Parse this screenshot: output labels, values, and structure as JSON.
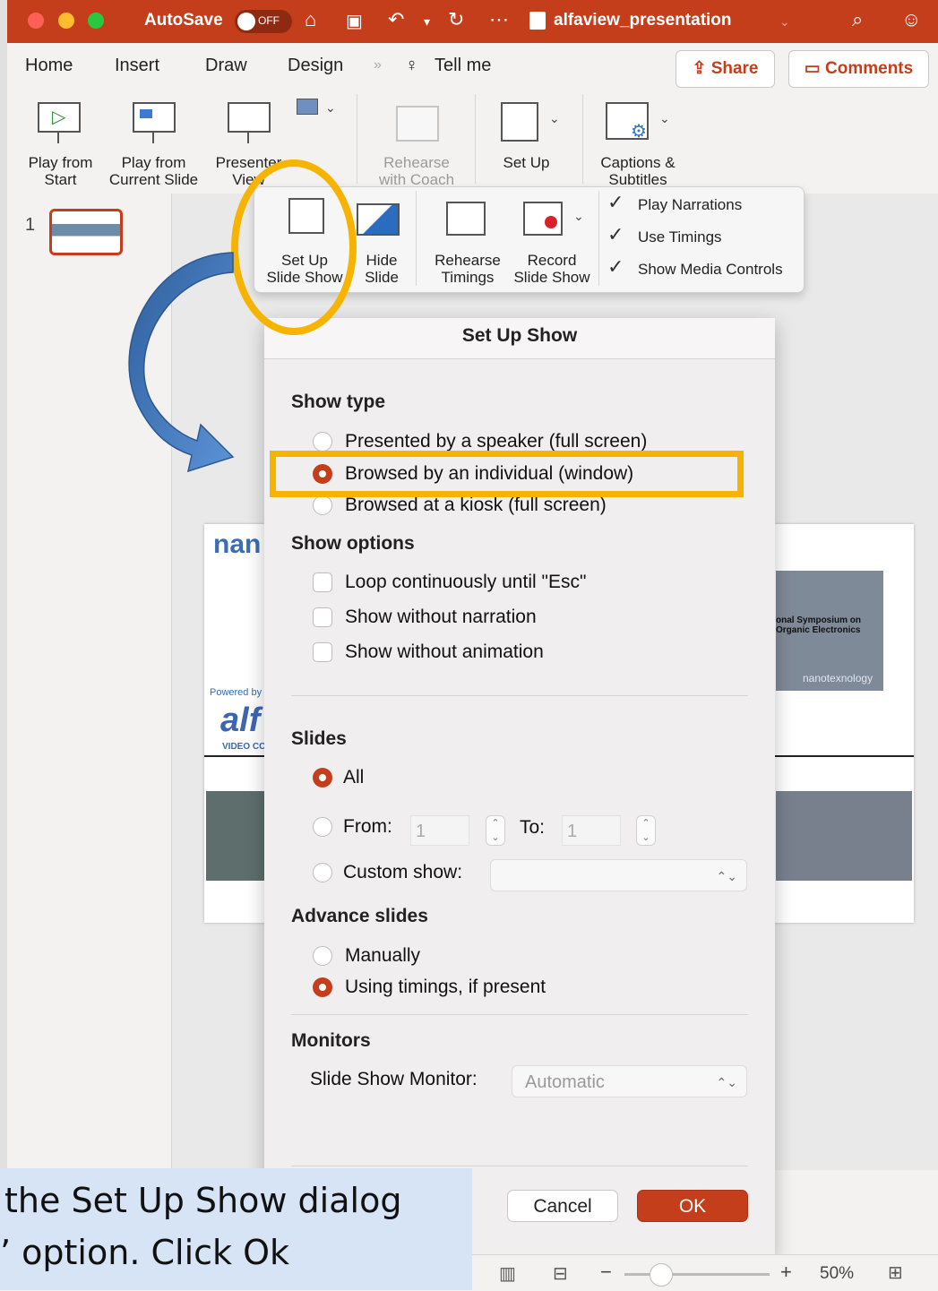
{
  "titlebar": {
    "autosave_label": "AutoSave",
    "autosave_state": "OFF",
    "document_title": "alfaview_presentation",
    "colors": {
      "accent": "#c43e1c"
    }
  },
  "ribbon": {
    "tabs": [
      "Home",
      "Insert",
      "Draw",
      "Design",
      "Tell me"
    ],
    "share_label": "Share",
    "comments_label": "Comments",
    "groups": {
      "play_from_start": "Play from\nStart",
      "play_from_current": "Play from\nCurrent Slide",
      "presenter_view": "Presenter\nView",
      "rehearse_with_coach": "Rehearse\nwith Coach",
      "set_up": "Set Up",
      "captions_subtitles": "Captions &\nSubtitles"
    }
  },
  "setup_menu": {
    "buttons": [
      "Set Up\nSlide Show",
      "Hide\nSlide",
      "Rehearse\nTimings",
      "Record\nSlide Show"
    ],
    "checks": [
      {
        "label": "Play Narrations",
        "checked": true
      },
      {
        "label": "Use Timings",
        "checked": true
      },
      {
        "label": "Show Media Controls",
        "checked": true
      }
    ]
  },
  "slide_pane": {
    "slide_number": "1"
  },
  "slide": {
    "logo_text": "nan",
    "powered_by": "Powered by",
    "alfaview_logo": "alf",
    "video_conf": "VIDEO CC",
    "right_box_text": "onal Symposium on\nOrganic Electronics",
    "right_box_tag": "nanotexnology"
  },
  "dialog": {
    "title": "Set Up Show",
    "show_type": {
      "heading": "Show type",
      "options": [
        {
          "label": "Presented by a speaker (full screen)",
          "selected": false
        },
        {
          "label": "Browsed by an individual (window)",
          "selected": true
        },
        {
          "label": "Browsed at a kiosk (full screen)",
          "selected": false
        }
      ]
    },
    "show_options": {
      "heading": "Show options",
      "checks": [
        {
          "label": "Loop continuously until \"Esc\"",
          "checked": false
        },
        {
          "label": "Show without narration",
          "checked": false
        },
        {
          "label": "Show without animation",
          "checked": false
        }
      ]
    },
    "slides": {
      "heading": "Slides",
      "all_label": "All",
      "from_label": "From:",
      "from_value": "1",
      "to_label": "To:",
      "to_value": "1",
      "custom_label": "Custom show:",
      "selected": "All"
    },
    "advance": {
      "heading": "Advance slides",
      "manually": "Manually",
      "using_timings": "Using timings, if present",
      "selected": "Using timings, if present"
    },
    "monitors": {
      "heading": "Monitors",
      "slide_show_monitor_label": "Slide Show Monitor:",
      "slide_show_monitor_value": "Automatic"
    },
    "cancel_label": "Cancel",
    "ok_label": "OK"
  },
  "statusbar": {
    "zoom": "50%"
  },
  "caption": {
    "line1": "the Set Up Show dialog",
    "line2": "’ option. Click Ok"
  },
  "annotation_color": "#f6b400"
}
